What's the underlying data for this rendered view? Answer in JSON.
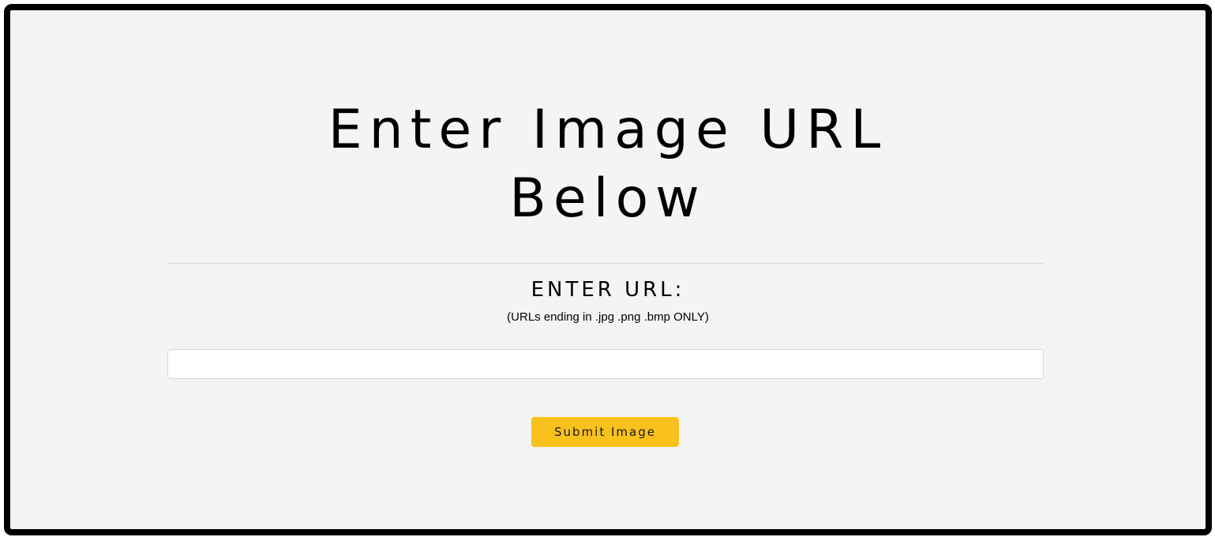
{
  "page": {
    "title_line1": "Enter Image URL",
    "title_line2": "Below"
  },
  "form": {
    "label": "ENTER URL:",
    "hint": "(URLs ending in .jpg .png .bmp ONLY)",
    "url_value": "",
    "submit_label": "Submit Image"
  },
  "colors": {
    "frame_border": "#000000",
    "background": "#f4f4f4",
    "button_accent": "#f8c11c",
    "divider": "#d8d8d8"
  }
}
